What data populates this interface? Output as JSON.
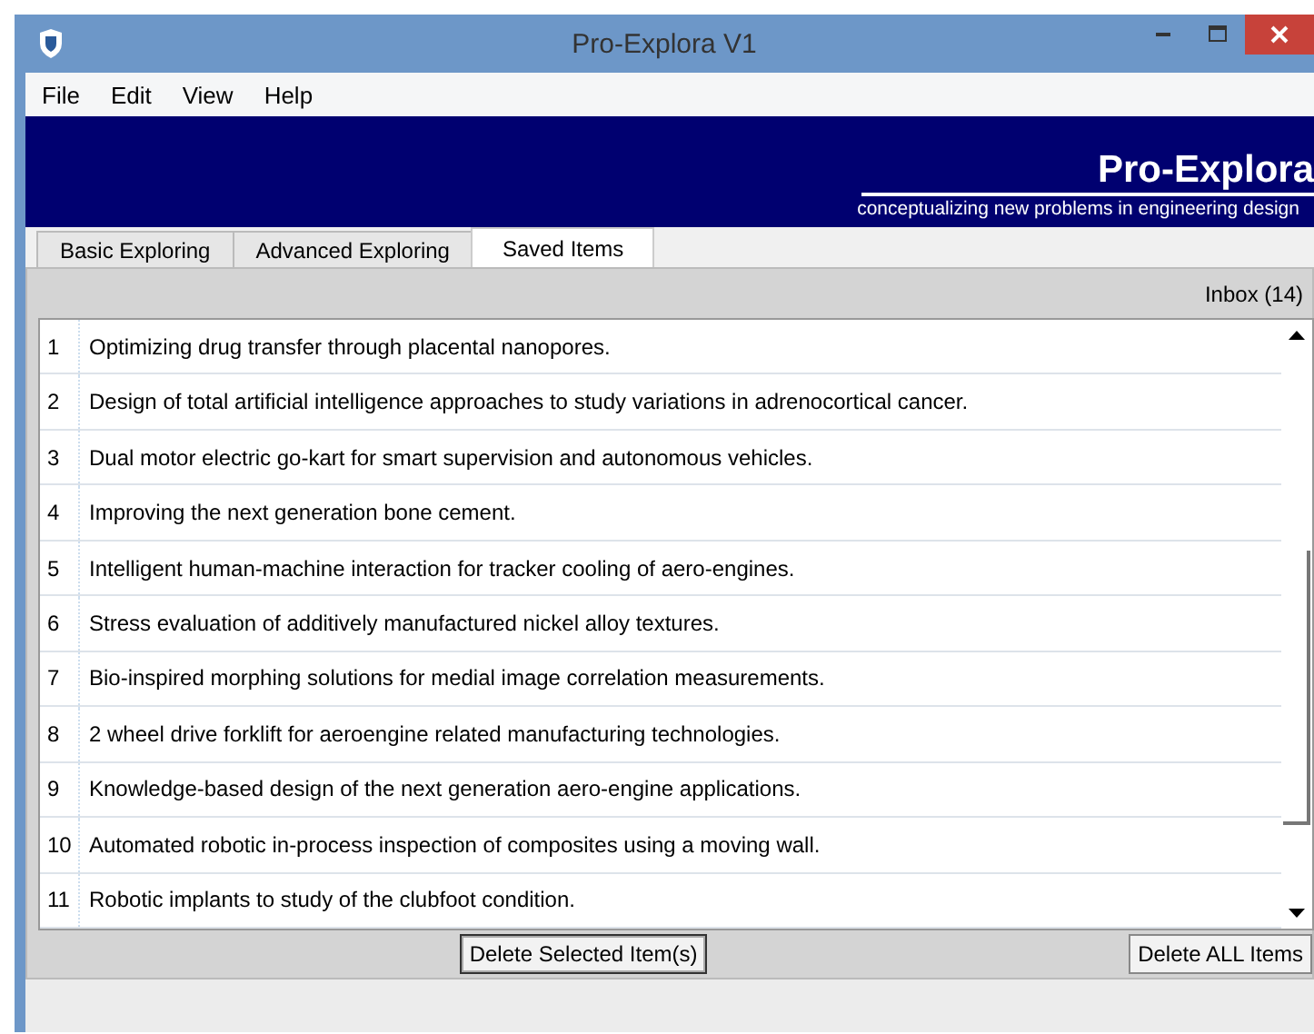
{
  "window": {
    "title": "Pro-Explora V1"
  },
  "menu": [
    "File",
    "Edit",
    "View",
    "Help"
  ],
  "banner": {
    "title": "Pro-Explora",
    "subtitle": "conceptualizing new problems in engineering design"
  },
  "tabs": [
    {
      "label": "Basic Exploring",
      "selected": false
    },
    {
      "label": "Advanced Exploring",
      "selected": false
    },
    {
      "label": "Saved Items",
      "selected": true
    }
  ],
  "inbox": "Inbox (14)",
  "items": [
    {
      "number": "1",
      "text": "Optimizing drug transfer through placental nanopores."
    },
    {
      "number": "2",
      "text": "Design of total artificial intelligence approaches to study variations in adrenocortical cancer."
    },
    {
      "number": "3",
      "text": "Dual motor electric go-kart for smart supervision and autonomous vehicles."
    },
    {
      "number": "4",
      "text": "Improving the next generation bone cement."
    },
    {
      "number": "5",
      "text": "Intelligent human-machine interaction for tracker cooling of aero-engines."
    },
    {
      "number": "6",
      "text": "Stress evaluation of additively manufactured nickel alloy textures."
    },
    {
      "number": "7",
      "text": "Bio-inspired morphing solutions for medial image correlation measurements."
    },
    {
      "number": "8",
      "text": "2 wheel drive forklift for aeroengine related manufacturing technologies."
    },
    {
      "number": "9",
      "text": "Knowledge-based design of the next generation aero-engine applications."
    },
    {
      "number": "10",
      "text": "Automated robotic in-process inspection of composites using a moving wall."
    },
    {
      "number": "11",
      "text": "Robotic implants to study of the clubfoot condition."
    }
  ],
  "buttons": [
    "Delete Selected Item(s)",
    "Delete ALL Items"
  ]
}
